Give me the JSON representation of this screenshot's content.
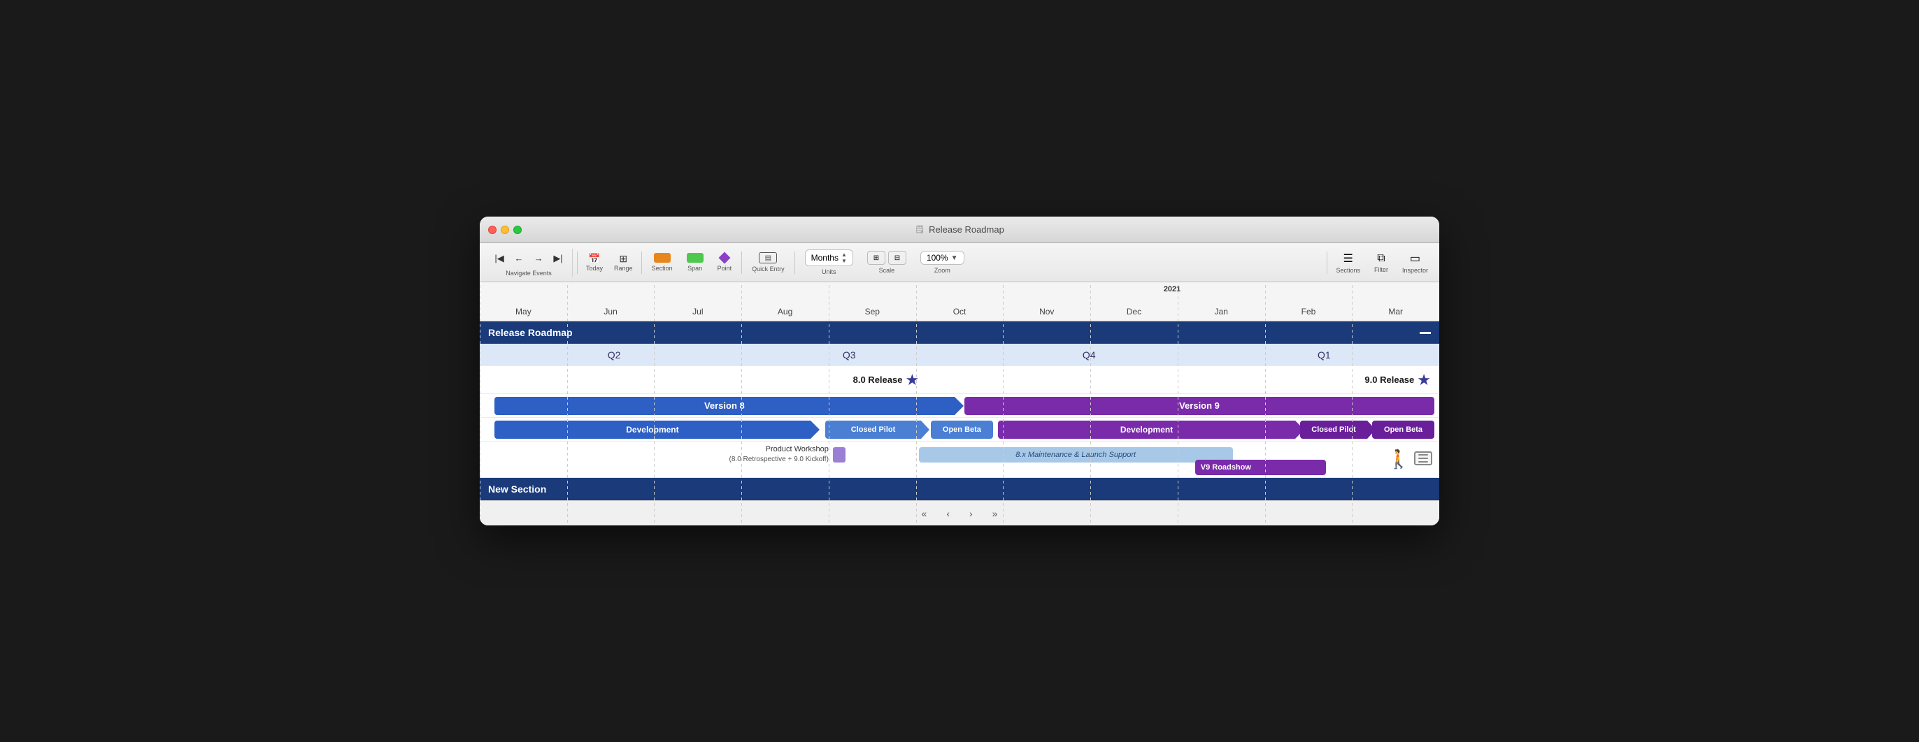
{
  "window": {
    "title": "Release Roadmap",
    "title_icon": "📋"
  },
  "toolbar": {
    "navigate_label": "Navigate Events",
    "today_label": "Today",
    "range_label": "Range",
    "section_label": "Section",
    "span_label": "Span",
    "point_label": "Point",
    "quick_entry_label": "Quick Entry",
    "units_label": "Units",
    "units_value": "Months",
    "scale_label": "Scale",
    "zoom_label": "Zoom",
    "zoom_value": "100%",
    "sections_label": "Sections",
    "filter_label": "Filter",
    "inspector_label": "Inspector"
  },
  "timeline": {
    "months": [
      "May",
      "Jun",
      "Jul",
      "Aug",
      "Sep",
      "Oct",
      "Nov",
      "Dec",
      "Jan",
      "Feb",
      "Mar"
    ],
    "year_2021": "2021"
  },
  "sections": [
    {
      "title": "Release Roadmap",
      "quarters": [
        "Q2",
        "Q3",
        "Q4",
        "Q1"
      ],
      "milestones": [
        {
          "label": "8.0 Release",
          "position_pct": 52.5
        },
        {
          "label": "9.0 Release",
          "position_pct": 98.5
        }
      ],
      "bars": [
        {
          "id": "version8",
          "label": "Version 8",
          "color": "blue",
          "left_pct": 2,
          "width_pct": 48
        },
        {
          "id": "version9",
          "label": "Version 9",
          "color": "purple",
          "left_pct": 52,
          "width_pct": 47
        },
        {
          "id": "dev8",
          "label": "Development",
          "color": "blue",
          "left_pct": 2,
          "width_pct": 33
        },
        {
          "id": "pilot8",
          "label": "Closed Pilot",
          "color": "blue_light",
          "left_pct": 36.5,
          "width_pct": 9.5
        },
        {
          "id": "beta8",
          "label": "Open Beta",
          "color": "blue_light",
          "left_pct": 46.5,
          "width_pct": 7
        },
        {
          "id": "dev9",
          "label": "Development",
          "color": "purple",
          "left_pct": 54.5,
          "width_pct": 30
        },
        {
          "id": "pilot9",
          "label": "Closed Pilot",
          "color": "purple_dark",
          "left_pct": 85.5,
          "width_pct": 7.5
        },
        {
          "id": "beta9",
          "label": "Open Beta",
          "color": "purple_dark",
          "left_pct": 93.5,
          "width_pct": 5.5
        }
      ],
      "misc_items": [
        {
          "id": "workshop_label",
          "text": "Product Workshop",
          "subtext": "(8.0 Retrospective + 9.0 Kickoff)"
        },
        {
          "id": "maintenance",
          "label": "8.x Maintenance & Launch Support"
        },
        {
          "id": "roadshow",
          "label": "V9 Roadshow"
        }
      ]
    },
    {
      "title": "New Section"
    }
  ],
  "bottom_nav": {
    "buttons": [
      "«",
      "‹",
      "›",
      "»"
    ]
  }
}
